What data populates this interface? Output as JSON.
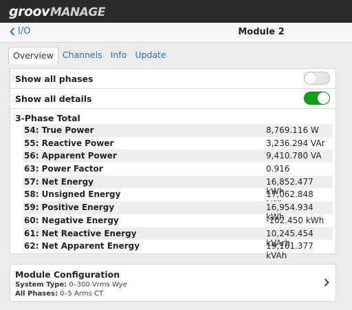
{
  "app": {
    "logo_part1": "groov",
    "logo_part2": "MANAGE"
  },
  "nav": {
    "back_label": "I/O",
    "title": "Module 2"
  },
  "tabs": [
    {
      "label": "Overview",
      "active": true
    },
    {
      "label": "Channels",
      "active": false
    },
    {
      "label": "Info",
      "active": false
    },
    {
      "label": "Update",
      "active": false
    }
  ],
  "toggles": {
    "show_all_phases": {
      "label": "Show all phases",
      "on": false
    },
    "show_all_details": {
      "label": "Show all details",
      "on": true
    }
  },
  "section_title": "3-Phase Total",
  "rows": [
    {
      "name": "54: True Power",
      "value": "8,769.116 W"
    },
    {
      "name": "55: Reactive Power",
      "value": "3,236.294 VAr"
    },
    {
      "name": "56: Apparent Power",
      "value": "9,410.780 VA"
    },
    {
      "name": "63: Power Factor",
      "value": "0.916"
    },
    {
      "name": "57: Net Energy",
      "value": "16,852.477 kWh"
    },
    {
      "name": "58: Unsigned Energy",
      "value": "17,062.848 kWh"
    },
    {
      "name": "59: Positive Energy",
      "value": "16,954.934 kWh"
    },
    {
      "name": "60: Negative Energy",
      "value": "-102.450 kWh"
    },
    {
      "name": "61: Net Reactive Energy",
      "value": "10,245.454 kVArh"
    },
    {
      "name": "62: Net Apparent Energy",
      "value": "19,161.377 kVAh"
    }
  ],
  "config": {
    "title": "Module Configuration",
    "system_type_label": "System Type:",
    "system_type_value": "0–300 Vrms Wye",
    "all_phases_label": "All Phases:",
    "all_phases_value": "0–5 Arms CT"
  },
  "colors": {
    "accent": "#2a6ebc",
    "toggle_on": "#12a01a",
    "topbar": "#2b2b2b"
  }
}
